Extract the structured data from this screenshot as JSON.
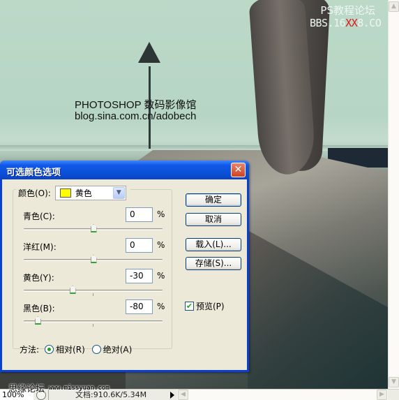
{
  "canvas": {
    "watermark_line1": "PHOTOSHOP 数码影像馆",
    "watermark_line2": "blog.sina.com.cn/adobech",
    "forum_title": "PS教程论坛",
    "bbs_prefix": "BBS.16",
    "bbs_red": "XX",
    "bbs_suffix": "8.CO",
    "bbs_red_color": "#e0151a"
  },
  "dialog": {
    "title": "可选颜色选项",
    "close_icon": "close-x-icon",
    "colors": {
      "label": "颜色(O):",
      "selected": "黄色",
      "swatch_color": "#ffff00"
    },
    "sliders": [
      {
        "label": "青色(C):",
        "value": "0",
        "unit": "%",
        "fraction": 0.5
      },
      {
        "label": "洋红(M):",
        "value": "0",
        "unit": "%",
        "fraction": 0.5
      },
      {
        "label": "黄色(Y):",
        "value": "-30",
        "unit": "%",
        "fraction": 0.35
      },
      {
        "label": "黑色(B):",
        "value": "-80",
        "unit": "%",
        "fraction": 0.1
      }
    ],
    "buttons": {
      "ok": "确定",
      "cancel": "取消",
      "load": "载入(L)...",
      "save": "存储(S)..."
    },
    "preview": {
      "label": "预览(P)",
      "checked": true
    },
    "method": {
      "label": "方法:",
      "options": [
        {
          "label": "相对(R)",
          "selected": true
        },
        {
          "label": "绝对(A)",
          "selected": false
        }
      ]
    }
  },
  "statusbar": {
    "zoom": "100%",
    "doc_info": "文档:910.6K/5.34M",
    "forum_watermark": "思缘论坛",
    "url_watermark": "www.missyuan.com"
  }
}
